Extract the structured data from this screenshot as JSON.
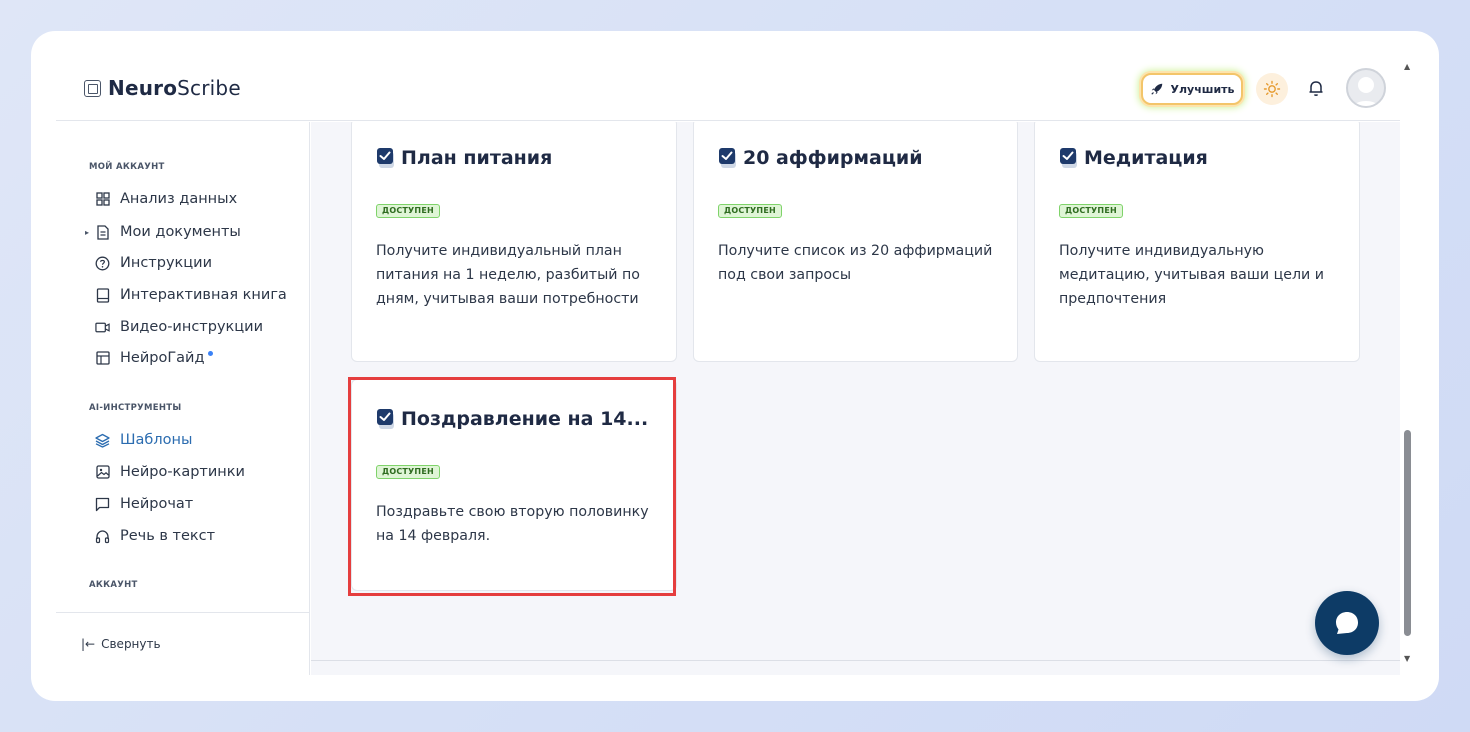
{
  "header": {
    "logo_bold": "Neuro",
    "logo_regular": "Scribe",
    "upgrade_label": "Улучшить"
  },
  "sidebar": {
    "section_account": "МОЙ АККАУНТ",
    "account_items": [
      {
        "label": "Анализ данных",
        "icon": "grid-icon"
      },
      {
        "label": "Мои документы",
        "icon": "document-icon"
      },
      {
        "label": "Инструкции",
        "icon": "question-icon"
      },
      {
        "label": "Интерактивная книга",
        "icon": "book-icon"
      },
      {
        "label": "Видео-инструкции",
        "icon": "video-icon"
      },
      {
        "label": "НейроГайд",
        "icon": "layout-icon"
      }
    ],
    "section_ai": "AI-ИНСТРУМЕНТЫ",
    "ai_items": [
      {
        "label": "Шаблоны",
        "icon": "layers-icon"
      },
      {
        "label": "Нейро-картинки",
        "icon": "image-icon"
      },
      {
        "label": "Нейрочат",
        "icon": "chat-icon"
      },
      {
        "label": "Речь в текст",
        "icon": "headphones-icon"
      }
    ],
    "section_settings": "АККАУНТ",
    "collapse_label": "Свернуть"
  },
  "cards": [
    {
      "title": "План питания",
      "badge": "ДОСТУПЕН",
      "desc": "Получите индивидуальный план питания на 1 неделю, разбитый по дням, учитывая ваши потребности"
    },
    {
      "title": "20 аффирмаций",
      "badge": "ДОСТУПЕН",
      "desc": "Получите список из 20 аффирмаций под свои запросы"
    },
    {
      "title": "Медитация",
      "badge": "ДОСТУПЕН",
      "desc": "Получите индивидуальную медитацию, учитывая ваши цели и предпочтения"
    },
    {
      "title": "Поздравление на 14...",
      "badge": "ДОСТУПЕН",
      "desc": "Поздравьте свою вторую половинку на 14 февраля."
    }
  ],
  "colors": {
    "accent": "#2b6cb0",
    "badge_bg": "#dff5d6",
    "highlight": "#e53e3e",
    "chat_button": "#0d3b66"
  }
}
